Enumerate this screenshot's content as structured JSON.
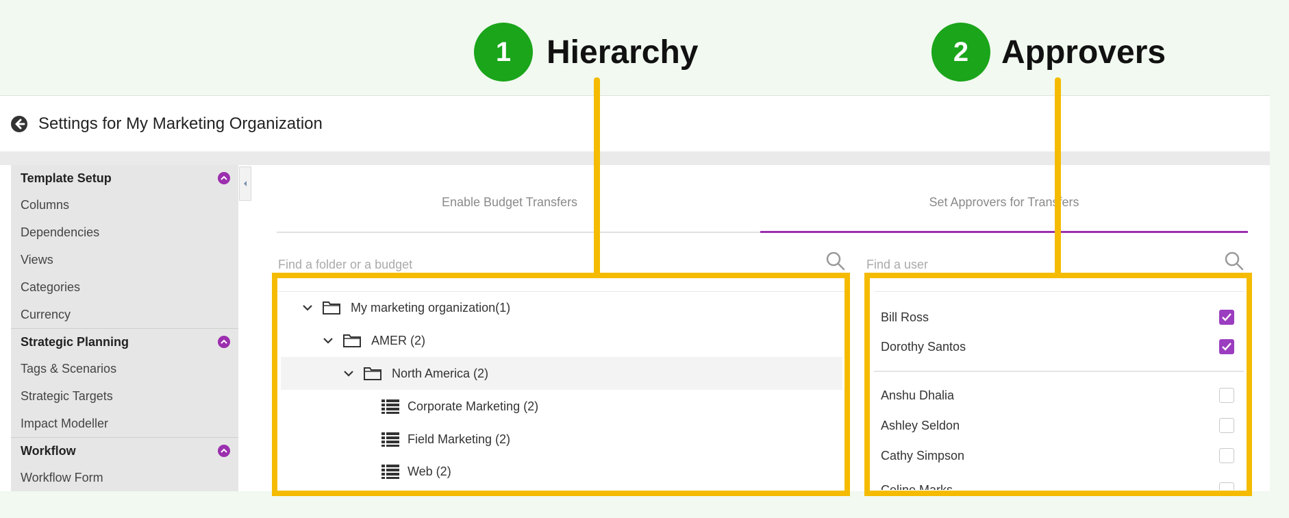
{
  "callouts": [
    {
      "number": "1",
      "title": "Hierarchy"
    },
    {
      "number": "2",
      "title": "Approvers"
    }
  ],
  "header": {
    "title": "Settings for My Marketing Organization"
  },
  "sidebar": {
    "sections": [
      {
        "title": "Template Setup",
        "items": [
          "Columns",
          "Dependencies",
          "Views",
          "Categories",
          "Currency"
        ]
      },
      {
        "title": "Strategic Planning",
        "items": [
          "Tags & Scenarios",
          "Strategic Targets",
          "Impact Modeller"
        ]
      },
      {
        "title": "Workflow",
        "items": [
          "Workflow Form"
        ]
      }
    ]
  },
  "tabs": [
    {
      "label": "Enable Budget Transfers",
      "active": false
    },
    {
      "label": "Set Approvers for Transfers",
      "active": true
    }
  ],
  "hierarchy": {
    "search_placeholder": "Find a folder or a budget",
    "rows": [
      {
        "label": "My marketing organization(1)",
        "type": "folder",
        "expanded": true
      },
      {
        "label": "AMER (2)",
        "type": "folder",
        "expanded": true
      },
      {
        "label": "North America (2)",
        "type": "folder",
        "expanded": true,
        "highlighted": true
      },
      {
        "label": "Corporate Marketing (2)",
        "type": "budget"
      },
      {
        "label": "Field Marketing (2)",
        "type": "budget"
      },
      {
        "label": "Web (2)",
        "type": "budget"
      }
    ]
  },
  "approvers": {
    "search_placeholder": "Find a user",
    "selected": [
      {
        "name": "Bill Ross",
        "checked": true
      },
      {
        "name": "Dorothy Santos",
        "checked": true
      }
    ],
    "others": [
      {
        "name": "Anshu Dhalia",
        "checked": false
      },
      {
        "name": "Ashley Seldon",
        "checked": false
      },
      {
        "name": "Cathy Simpson",
        "checked": false
      },
      {
        "name": "Celine Marks",
        "checked": false
      }
    ]
  },
  "colors": {
    "accent": "#9b2fae",
    "callout_green": "#1aa51a",
    "highlight_yellow": "#f5bb00"
  }
}
